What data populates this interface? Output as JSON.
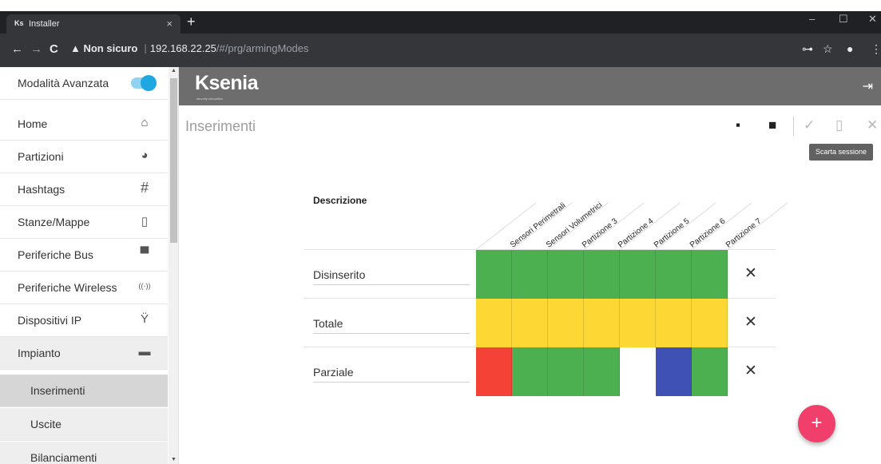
{
  "browser": {
    "tab_favicon": "Ks",
    "tab_title": "Installer",
    "tab_close": "×",
    "new_tab": "+",
    "window_min": "–",
    "window_max": "☐",
    "window_close": "✕",
    "back": "←",
    "forward": "→",
    "reload": "C",
    "security_warning": "▲ Non sicuro",
    "url_host": "192.168.22.25",
    "url_path": "/#/prg/armingModes",
    "key_icon": "⊶",
    "star_icon": "☆",
    "profile_icon": "●",
    "menu_icon": "⋮"
  },
  "sidebar": {
    "advanced_mode_label": "Modalità Avanzata",
    "advanced_mode_on": true,
    "items": [
      {
        "label": "Home",
        "icon": "home-icon",
        "glyph": "⌂"
      },
      {
        "label": "Partizioni",
        "icon": "pie-chart-icon",
        "glyph": "◕"
      },
      {
        "label": "Hashtags",
        "icon": "hashtag-icon",
        "glyph": "#"
      },
      {
        "label": "Stanze/Mappe",
        "icon": "door-icon",
        "glyph": "▯"
      },
      {
        "label": "Periferiche Bus",
        "icon": "monitor-icon",
        "glyph": "▀"
      },
      {
        "label": "Periferiche Wireless",
        "icon": "wireless-icon",
        "glyph": "((·))"
      },
      {
        "label": "Dispositivi IP",
        "icon": "plug-icon",
        "glyph": "Ÿ"
      },
      {
        "label": "Impianto",
        "icon": "briefcase-icon",
        "glyph": "▬"
      }
    ],
    "subitems": [
      {
        "label": "Inserimenti"
      },
      {
        "label": "Uscite"
      },
      {
        "label": "Bilanciamenti"
      }
    ],
    "scroll_up": "▲",
    "scroll_down": "▼"
  },
  "header": {
    "logo_ks": "Ks",
    "logo_text": "enia",
    "logo_tagline": "security innovation",
    "logout_icon": "⇥"
  },
  "page": {
    "title": "Inserimenti",
    "tool_save": "▪",
    "tool_delete": "■",
    "tool_confirm": "✓",
    "tool_discard": "▯",
    "tool_close": "✕",
    "tooltip": "Scarta sessione"
  },
  "table": {
    "description_header": "Descrizione",
    "columns": [
      "Sensori Perimetrali",
      "Sensori Volumetrici",
      "Partizione 3",
      "Partizione 4",
      "Partizione 5",
      "Partizione 6",
      "Partizione 7"
    ],
    "colors": {
      "green": "#4caf50",
      "yellow": "#fdd835",
      "red": "#f44336",
      "blue": "#3f51b5",
      "empty": "#ffffff"
    },
    "rows": [
      {
        "label": "Disinserito",
        "cells": [
          "green",
          "green",
          "green",
          "green",
          "green",
          "green",
          "green"
        ],
        "remove": "✕"
      },
      {
        "label": "Totale",
        "cells": [
          "yellow",
          "yellow",
          "yellow",
          "yellow",
          "yellow",
          "yellow",
          "yellow"
        ],
        "remove": "✕"
      },
      {
        "label": "Parziale",
        "cells": [
          "red",
          "green",
          "green",
          "green",
          "empty",
          "blue",
          "green"
        ],
        "remove": "✕"
      }
    ]
  },
  "fab": {
    "label": "+"
  }
}
